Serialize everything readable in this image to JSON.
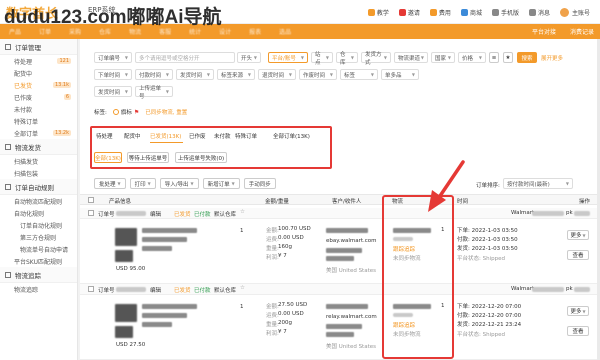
{
  "header": {
    "logo_text": "数字酋长",
    "system_name": "ERP系统",
    "watermark": "dudu123.com嘟嘟Ai导航",
    "links": [
      {
        "label": "教学",
        "icon": "teach-icon",
        "color": "#f39a2a"
      },
      {
        "label": "邀请",
        "icon": "invite-icon",
        "color": "#e53935"
      },
      {
        "label": "费用",
        "icon": "fee-icon",
        "color": "#f39a2a"
      },
      {
        "label": "商城",
        "icon": "shop-icon",
        "color": "#3c8bd9"
      },
      {
        "label": "手机版",
        "icon": "phone-icon",
        "color": "#888888"
      },
      {
        "label": "消息",
        "icon": "bell-icon",
        "color": "#888888"
      },
      {
        "label": "主账号",
        "icon": "avatar-icon",
        "color": "#f0a24a"
      }
    ]
  },
  "nav": {
    "items": [
      "产品",
      "订单",
      "采购",
      "仓库",
      "物流",
      "客服",
      "统计",
      "设计",
      "报表",
      "选品"
    ],
    "right": [
      "平台对接",
      "消费记录"
    ]
  },
  "sidebar": {
    "groups": [
      {
        "label": "订单管理",
        "icon": "order-icon",
        "items": [
          {
            "label": "待处理",
            "badge": "121",
            "active": false,
            "sub": false
          },
          {
            "label": "配货中",
            "badge": "",
            "active": false,
            "sub": false
          },
          {
            "label": "已发货",
            "badge": "13.1k",
            "active": true,
            "sub": false
          },
          {
            "label": "已作废",
            "badge": "6",
            "active": false,
            "sub": false
          },
          {
            "label": "未付款",
            "badge": "",
            "active": false,
            "sub": false
          },
          {
            "label": "特殊订单",
            "badge": "",
            "active": false,
            "sub": false
          },
          {
            "label": "全部订单",
            "badge": "13.2k",
            "active": false,
            "sub": false
          }
        ]
      },
      {
        "label": "物流发货",
        "icon": "truck-icon",
        "items": [
          {
            "label": "扫描发货",
            "badge": "",
            "active": false,
            "sub": false
          },
          {
            "label": "扫描包装",
            "badge": "",
            "active": false,
            "sub": false
          }
        ]
      },
      {
        "label": "订单自动规则",
        "icon": "rule-icon",
        "items": [
          {
            "label": "自动物流匹配规则",
            "badge": "",
            "active": false,
            "sub": false
          },
          {
            "label": "自动化规则",
            "badge": "",
            "active": false,
            "sub": false
          },
          {
            "label": "订单自动化规则",
            "badge": "",
            "active": false,
            "sub": true
          },
          {
            "label": "第三方仓规则",
            "badge": "",
            "active": false,
            "sub": true
          },
          {
            "label": "物流单号自动申请",
            "badge": "",
            "active": false,
            "sub": true
          },
          {
            "label": "平台SKU匹配规则",
            "badge": "",
            "active": false,
            "sub": false
          }
        ]
      },
      {
        "label": "物流追踪",
        "icon": "track-icon",
        "items": [
          {
            "label": "物流追踪",
            "badge": "",
            "active": false,
            "sub": false
          }
        ]
      }
    ]
  },
  "filters": {
    "row1": {
      "search_type": "订单编号",
      "search_placeholder": "多个请用逗号或空格分开",
      "match": "开头",
      "selects": [
        "平台/账号",
        "站点",
        "仓库",
        "发货方式",
        "物流渠道",
        "国家",
        "价格"
      ],
      "search_btn": "搜索",
      "advanced": "展开更多"
    },
    "row2": [
      "下单时间",
      "付款时间",
      "发货时间",
      "标签来源",
      "退货时间",
      "作废时间",
      "标签",
      "单多品"
    ],
    "row3": [
      "发货时间",
      "上传运单号"
    ],
    "tag_label": "标签:",
    "tag_opt1": "旗标",
    "tag_opt2": "已同步物流, 重置"
  },
  "tabs": {
    "items": [
      {
        "label": "待处理",
        "active": false
      },
      {
        "label": "配货中",
        "active": false
      },
      {
        "label": "已发货(13K)",
        "active": true
      },
      {
        "label": "已作废",
        "active": false
      },
      {
        "label": "未付款",
        "active": false
      },
      {
        "label": "特殊订单",
        "active": false
      },
      {
        "label": "全部订单(13K)",
        "active": false
      }
    ],
    "sub": [
      {
        "label": "全部(13K)",
        "active": true
      },
      {
        "label": "等待上传运单号",
        "active": false
      },
      {
        "label": "上传运单号失败(0)",
        "active": false
      }
    ]
  },
  "actions": {
    "buttons": [
      "批处理",
      "打印",
      "导入/导出",
      "新增订单",
      "手动同步"
    ],
    "sort_label": "订单排序:",
    "sort_value": "按付款时间(最新)"
  },
  "table": {
    "headers": [
      "产品信息",
      "金额/重量",
      "客户/收件人",
      "物流",
      "时间",
      "操作"
    ],
    "rows": [
      {
        "tags": [
          "订单号",
          "编辑",
          "已发货",
          "已付款",
          "默认仓库"
        ],
        "product_price": "USD 95.00",
        "qty": "1",
        "amount_label": "金额:",
        "amount": "100.70 USD",
        "cost_label": "运费:",
        "cost": "0.00 USD",
        "weight_label": "重量:",
        "weight": "160g",
        "profit_label": "利润:",
        "profit": "¥ 7",
        "customer_email": "ebay.walmart.com",
        "country": "美国 United States",
        "logistics_qty": "1",
        "logistics_status": "跟踪追踪",
        "logistics_note": "未同步物流",
        "times": [
          "下单: 2022-1-03 03:50",
          "付款: 2022-1-03 03:50",
          "发货: 2022-1-03 03:50"
        ],
        "platform_status": "平台状态: Shipped",
        "shop": "Walmart",
        "more_btn": "更多",
        "view_btn": "查看"
      },
      {
        "tags": [
          "订单号",
          "编辑",
          "已发货",
          "已付款",
          "默认仓库"
        ],
        "product_price": "USD 27.50",
        "qty": "1",
        "amount_label": "金额:",
        "amount": "27.50 USD",
        "cost_label": "运费:",
        "cost": "0.00 USD",
        "weight_label": "重量:",
        "weight": "200g",
        "profit_label": "利润:",
        "profit": "¥ 7",
        "customer_email": "relay.walmart.com",
        "country": "美国 United States",
        "logistics_qty": "1",
        "logistics_status": "跟踪追踪",
        "logistics_note": "未同步物流",
        "times": [
          "下单: 2022-12-20 07:00",
          "付款: 2022-12-20 07:00",
          "发货: 2022-12-21 23:24"
        ],
        "platform_status": "平台状态: Shipped",
        "shop": "Walmart",
        "more_btn": "更多",
        "view_btn": "查看"
      }
    ]
  },
  "colors": {
    "accent": "#f39a2a",
    "highlight": "#e53935",
    "green": "#2e9b4d"
  }
}
